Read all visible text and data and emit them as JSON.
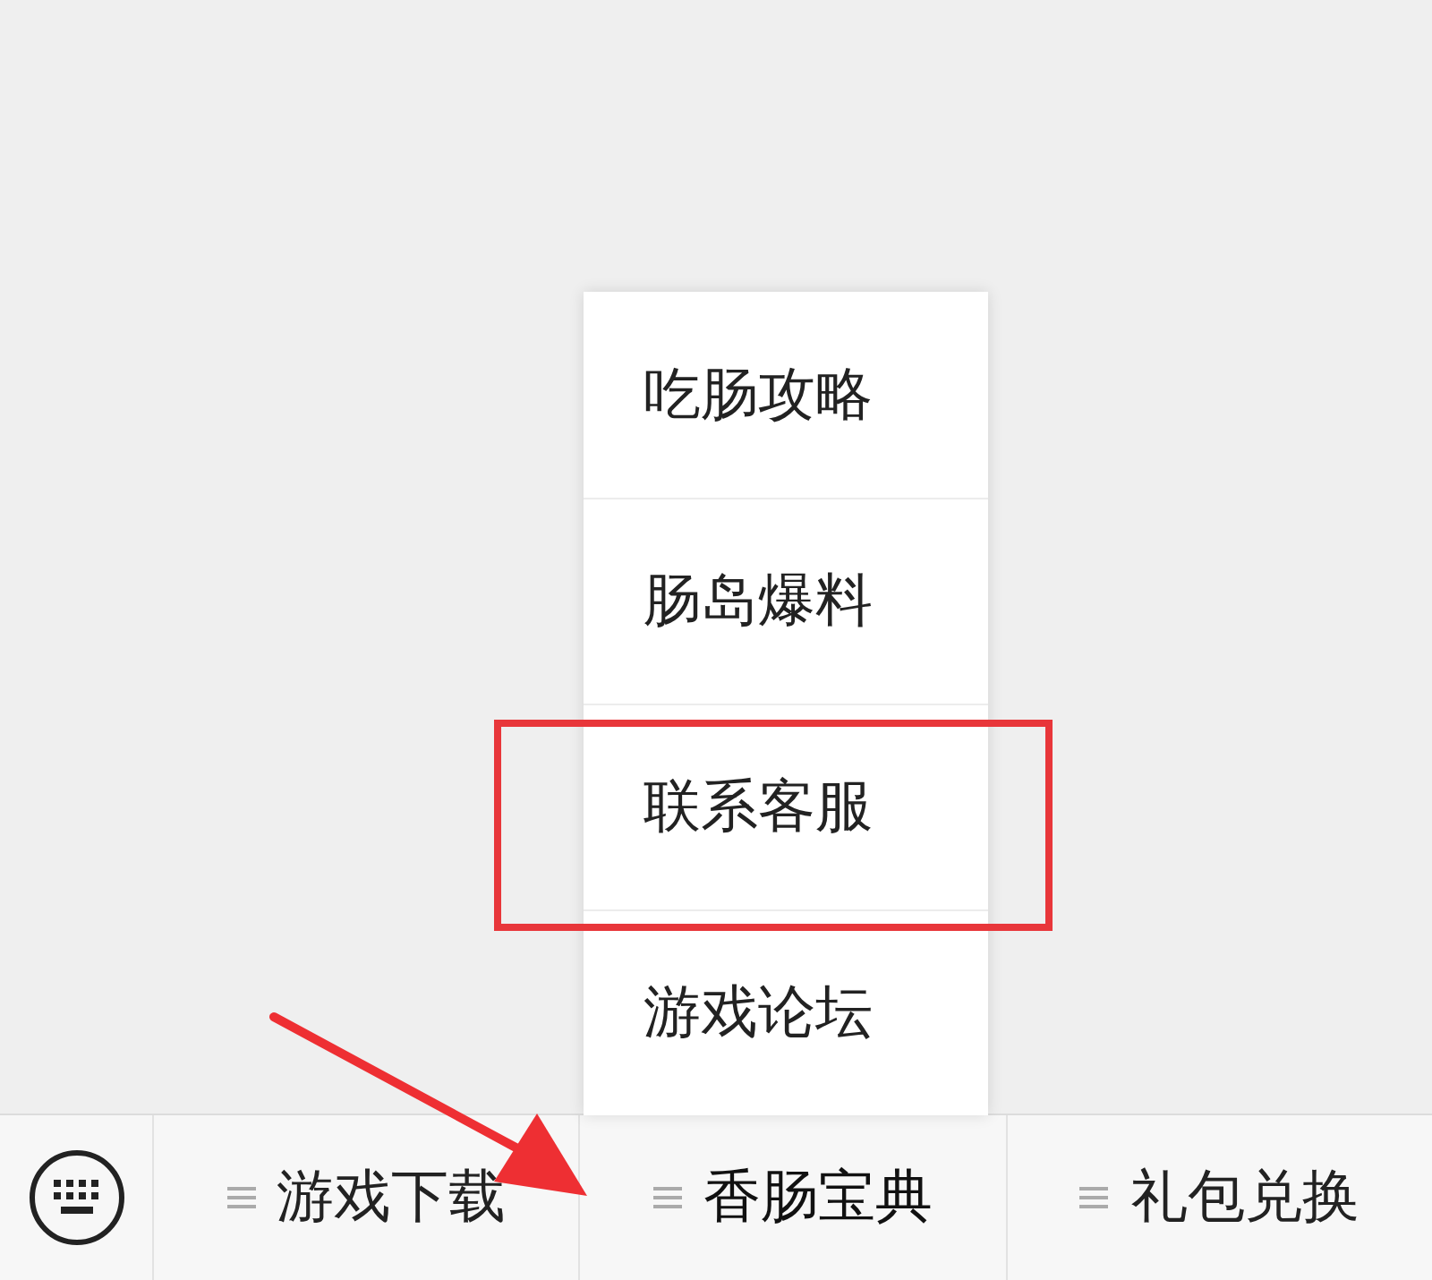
{
  "menu": {
    "items": [
      {
        "label": "吃肠攻略",
        "highlighted": false
      },
      {
        "label": "肠岛爆料",
        "highlighted": false
      },
      {
        "label": "联系客服",
        "highlighted": true
      },
      {
        "label": "游戏论坛",
        "highlighted": false
      }
    ]
  },
  "bottom_bar": {
    "tabs": [
      {
        "label": "游戏下载",
        "expanded": false
      },
      {
        "label": "香肠宝典",
        "expanded": true
      },
      {
        "label": "礼包兑换",
        "expanded": false
      }
    ]
  }
}
